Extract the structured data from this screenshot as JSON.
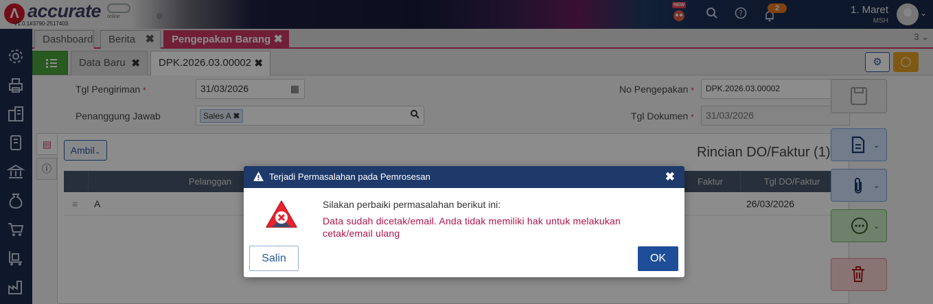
{
  "app": {
    "logo_text": "accurate",
    "logo_sub": "online",
    "version": "V1.0.1#3790-2517403",
    "new_badge": "NEW",
    "notification_count": "2",
    "user_name": "1. Maret",
    "company": "MSH"
  },
  "tabs": [
    {
      "label": "Dashboard",
      "active": false,
      "closable": false
    },
    {
      "label": "Berita",
      "active": false,
      "closable": true
    },
    {
      "label": "Pengepakan Barang",
      "active": true,
      "closable": true
    }
  ],
  "tab_count": "3",
  "sub_tabs": [
    {
      "label": "Data Baru",
      "active": false
    },
    {
      "label": "DPK.2026.03.00002",
      "active": true
    }
  ],
  "form": {
    "tgl_pengiriman_label": "Tgl Pengiriman",
    "tgl_pengiriman_value": "31/03/2026",
    "penanggung_jawab_label": "Penanggung Jawab",
    "penanggung_jawab_chip": "Sales A",
    "no_pengepakan_label": "No Pengepakan",
    "no_pengepakan_value": "DPK.2026.03.00002",
    "tgl_dokumen_label": "Tgl Dokumen",
    "tgl_dokumen_value": "31/03/2026",
    "required_mark": "*"
  },
  "detail": {
    "ambil_label": "Ambil",
    "title": "Rincian DO/Faktur (1)",
    "columns": [
      "Pelanggan",
      "Faktur",
      "Tgl DO/Faktur"
    ],
    "rows": [
      {
        "pelanggan": "A",
        "tgl": "26/03/2026"
      }
    ]
  },
  "dialog": {
    "title": "Terjadi Permasalahan pada Pemrosesan",
    "heading": "Silakan perbaiki permasalahan berikut ini:",
    "message": "Data sudah dicetak/email. Anda tidak memiliki hak untuk melakukan cetak/email ulang",
    "copy_label": "Salin",
    "ok_label": "OK"
  },
  "colors": {
    "brand_red": "#cc3a63",
    "navy": "#1e3a6a",
    "error_text": "#b0124b",
    "sidebar": "#1d2b4f"
  }
}
